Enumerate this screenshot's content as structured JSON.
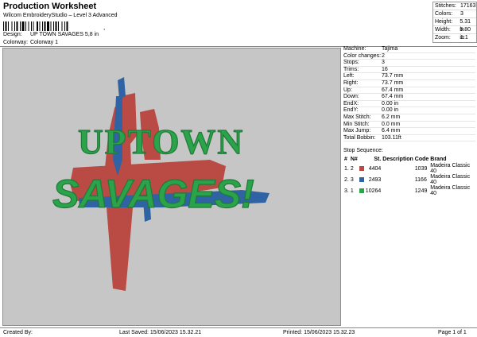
{
  "header": {
    "title": "Production Worksheet",
    "subtitle": "Wilcom EmbroideryStudio – Level 3 Advanced",
    "barcode_tail": ","
  },
  "meta": {
    "design_label": "Design:",
    "design_value": "UP TOWN SAVAGES 5,8 in",
    "colorway_label": "Colorway:",
    "colorway_value": "Colorway 1"
  },
  "stats": [
    {
      "label": "Stitches:",
      "value": "17163"
    },
    {
      "label": "Colors:",
      "value": "3"
    },
    {
      "label": "Height:",
      "value": "5.31 in"
    },
    {
      "label": "Width:",
      "value": "5.80 in"
    },
    {
      "label": "Zoom:",
      "value": "1:1"
    }
  ],
  "design": {
    "line1": "UPTOWN",
    "line2": "SAVAGES!",
    "colors": {
      "red": "#b94a44",
      "blue": "#2f63a3",
      "green": "#2aa34a",
      "green_dark": "#1f7a37"
    }
  },
  "machine_info": [
    {
      "label": "Machine:",
      "value": "Tajima"
    },
    {
      "label": "Color changes:",
      "value": "2"
    },
    {
      "label": "Stops:",
      "value": "3"
    },
    {
      "label": "Trims:",
      "value": "16"
    },
    {
      "label": "Left:",
      "value": "73.7 mm"
    },
    {
      "label": "Right:",
      "value": "73.7 mm"
    },
    {
      "label": "Up:",
      "value": "67.4 mm"
    },
    {
      "label": "Down:",
      "value": "67.4 mm"
    },
    {
      "label": "EndX:",
      "value": "0.00 in"
    },
    {
      "label": "EndY:",
      "value": "0.00 in"
    },
    {
      "label": "Max Stitch:",
      "value": "6.2 mm"
    },
    {
      "label": "Min Stitch:",
      "value": "0.0 mm"
    },
    {
      "label": "Max Jump:",
      "value": "6.4 mm"
    },
    {
      "label": "Total Bobbin:",
      "value": "103.11ft"
    }
  ],
  "stop_sequence": {
    "title": "Stop Sequence:",
    "headers": [
      "#",
      "N#",
      "St.",
      "Description",
      "Code",
      "Brand"
    ],
    "rows": [
      {
        "index": "1.",
        "n": "2",
        "color": "#b94a44",
        "stitches": "4404",
        "description": "",
        "code": "1039",
        "brand": "Madeira Classic 40"
      },
      {
        "index": "2.",
        "n": "3",
        "color": "#2f63a3",
        "stitches": "2493",
        "description": "",
        "code": "1166",
        "brand": "Madeira Classic 40"
      },
      {
        "index": "3.",
        "n": "1",
        "color": "#2aa34a",
        "stitches": "10264",
        "description": "",
        "code": "1249",
        "brand": "Madeira Classic 40"
      }
    ]
  },
  "footer": {
    "created_by": "Created By:",
    "last_saved": "Last Saved: 15/06/2023 15.32.21",
    "printed": "Printed: 15/06/2023 15.32.23",
    "page": "Page 1 of 1"
  }
}
